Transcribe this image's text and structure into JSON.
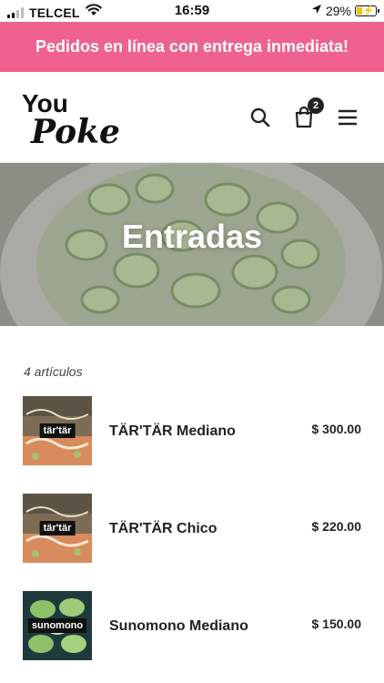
{
  "status_bar": {
    "carrier": "TELCEL",
    "time": "16:59",
    "battery_percent": "29%",
    "battery_level": 0.29,
    "icons": [
      "signal-icon",
      "wifi-icon",
      "location-arrow-icon",
      "battery-charging-icon"
    ]
  },
  "banner": {
    "text": "Pedidos en línea con entrega inmediata!",
    "color": "#f0628e"
  },
  "header": {
    "logo_text_top": "You",
    "logo_text_bottom": "Poke",
    "icons": [
      "search-icon",
      "cart-icon",
      "menu-icon"
    ],
    "cart_count": "2"
  },
  "hero": {
    "title": "Entradas"
  },
  "collection": {
    "count_label": "4 artículos",
    "products": [
      {
        "name": "TÄR'TÄR Mediano",
        "price": "$ 300.00",
        "thumb_label": "tär'tär"
      },
      {
        "name": "TÄR'TÄR Chico",
        "price": "$ 220.00",
        "thumb_label": "tär'tär"
      },
      {
        "name": "Sunomono Mediano",
        "price": "$ 150.00",
        "thumb_label": "sunomono"
      }
    ]
  }
}
